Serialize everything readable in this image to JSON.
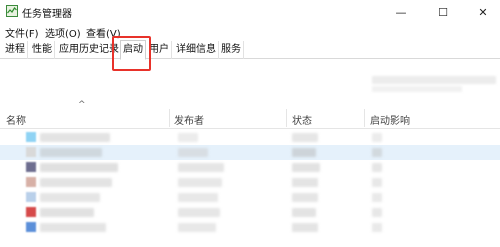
{
  "window": {
    "title": "任务管理器",
    "controls": {
      "minimize": "—",
      "maximize": "☐",
      "close": "✕"
    }
  },
  "menu": [
    "文件(F)",
    "选项(O)",
    "查看(V)"
  ],
  "tabs": [
    {
      "label": "进程",
      "active": false
    },
    {
      "label": "性能",
      "active": false
    },
    {
      "label": "应用历史记录",
      "active": false
    },
    {
      "label": "启动",
      "active": true
    },
    {
      "label": "用户",
      "active": false
    },
    {
      "label": "详细信息",
      "active": false
    },
    {
      "label": "服务",
      "active": false
    }
  ],
  "table": {
    "sort_indicator": "^",
    "columns": [
      "名称",
      "发布者",
      "状态",
      "启动影响"
    ],
    "row_icon_colors": [
      "#8fd3f4",
      "#d9d9d9",
      "#6d6d8f",
      "#d7b0a6",
      "#b9d0ea",
      "#d64a4a",
      "#5b8fd9"
    ]
  },
  "accent": {
    "highlight_box": "#e8322a",
    "selected_row": "#e5f1fb"
  }
}
